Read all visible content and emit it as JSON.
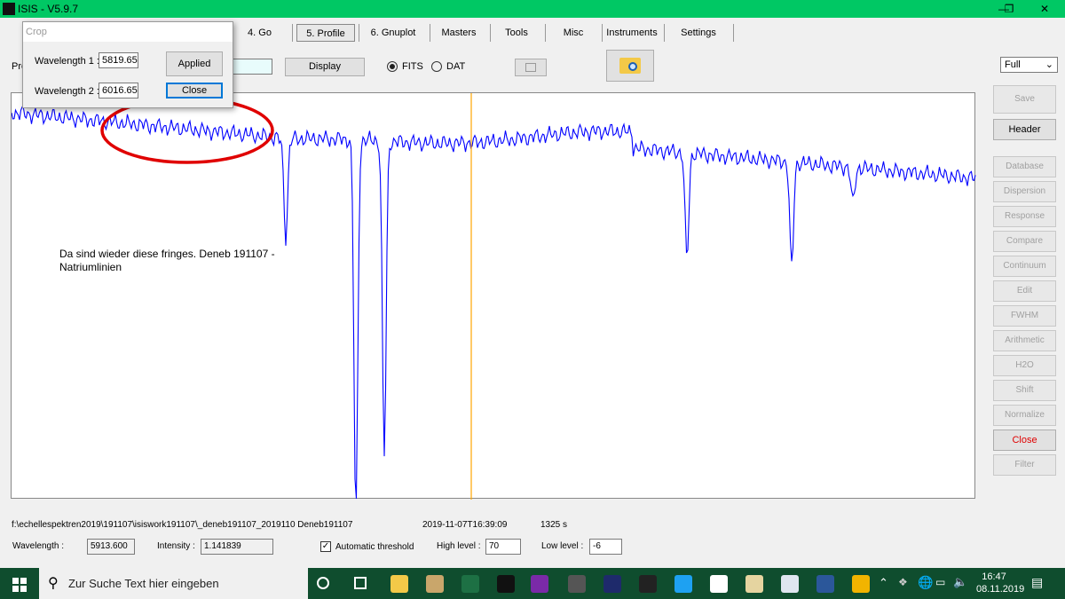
{
  "window": {
    "title": "ISIS - V5.9.7",
    "minimize": "—",
    "maximize": "❐",
    "close": "✕"
  },
  "tabs": [
    {
      "label": "4. Go"
    },
    {
      "label": "5. Profile"
    },
    {
      "label": "6. Gnuplot"
    },
    {
      "label": "Masters"
    },
    {
      "label": "Tools"
    },
    {
      "label": "Misc"
    },
    {
      "label": "Instruments"
    },
    {
      "label": "Settings"
    }
  ],
  "toolbar": {
    "profile_label": "Pro",
    "display": "Display",
    "fits": "FITS",
    "dat": "DAT",
    "zoom_select": "Full"
  },
  "crop_dialog": {
    "title": "Crop",
    "wl1_label": "Wavelength 1 :",
    "wl1_value": "5819.65",
    "wl2_label": "Wavelength 2 :",
    "wl2_value": "6016.65",
    "applied": "Applied",
    "close": "Close"
  },
  "plot": {
    "annotation_line1": "Da sind wieder diese fringes. Deneb 191107 -",
    "annotation_line2": "Natriumlinien",
    "line_color": "#0000ff",
    "cursor_color": "#ffa500",
    "marker_color": "#e00000"
  },
  "side_buttons": [
    {
      "label": "Save",
      "enabled": false
    },
    {
      "label": "Header",
      "enabled": true
    },
    {
      "label": "Database",
      "enabled": false
    },
    {
      "label": "Dispersion",
      "enabled": false
    },
    {
      "label": "Response",
      "enabled": false
    },
    {
      "label": "Compare",
      "enabled": false
    },
    {
      "label": "Continuum",
      "enabled": false
    },
    {
      "label": "Edit",
      "enabled": false
    },
    {
      "label": "FWHM",
      "enabled": false
    },
    {
      "label": "Arithmetic",
      "enabled": false
    },
    {
      "label": "H2O",
      "enabled": false
    },
    {
      "label": "Shift",
      "enabled": false
    },
    {
      "label": "Normalize",
      "enabled": false
    },
    {
      "label": "Close",
      "enabled": true,
      "color": "#e00000"
    },
    {
      "label": "Filter",
      "enabled": false
    }
  ],
  "status": {
    "path": "f:\\echellespektren2019\\191107\\isiswork191107\\_deneb191107_2019110 Deneb191107",
    "date": "2019-11-07T16:39:09",
    "exposure": "1325 s",
    "wavelength_label": "Wavelength :",
    "wavelength": "5913.600",
    "intensity_label": "Intensity :",
    "intensity": "1.141839",
    "auto_threshold": "Automatic threshold",
    "high_label": "High level :",
    "high": "70",
    "low_label": "Low level :",
    "low": "-6"
  },
  "taskbar": {
    "search_placeholder": "Zur Suche Text hier eingeben",
    "time": "16:47",
    "date": "08.11.2019"
  }
}
